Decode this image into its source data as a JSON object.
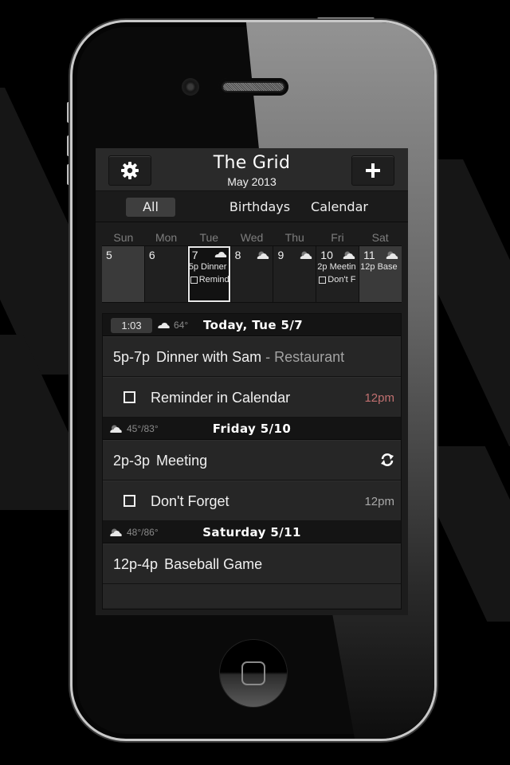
{
  "app": {
    "title": "The Grid",
    "subtitle": "May 2013",
    "settings_icon": "gear-icon",
    "add_icon": "plus-icon"
  },
  "filters": [
    {
      "label": "All",
      "active": true
    },
    {
      "label": "Birthdays",
      "active": false
    },
    {
      "label": "Calendar",
      "active": false
    }
  ],
  "week": {
    "day_names": [
      "Sun",
      "Mon",
      "Tue",
      "Wed",
      "Thu",
      "Fri",
      "Sat"
    ],
    "days": [
      {
        "num": "5",
        "weather": "",
        "event": "",
        "reminder": ""
      },
      {
        "num": "6",
        "weather": "",
        "event": "",
        "reminder": ""
      },
      {
        "num": "7",
        "weather": "cloud-icon",
        "event": "5p Dinner",
        "reminder": "Remind",
        "today": true
      },
      {
        "num": "8",
        "weather": "partly-cloudy-icon",
        "event": "",
        "reminder": ""
      },
      {
        "num": "9",
        "weather": "partly-cloudy-icon",
        "event": "",
        "reminder": ""
      },
      {
        "num": "10",
        "weather": "partly-cloudy-icon",
        "event": "2p Meetin",
        "reminder": "Don't F"
      },
      {
        "num": "11",
        "weather": "partly-cloudy-icon",
        "event": "12p Base",
        "reminder": ""
      }
    ]
  },
  "agenda": {
    "today": {
      "clock": "1:03",
      "temp": "64°",
      "title": "Today, Tue 5/7",
      "event": {
        "time": "5p-7p",
        "title": "Dinner with Sam",
        "location": "- Restaurant"
      },
      "reminder": {
        "title": "Reminder in Calendar",
        "time": "12pm"
      }
    },
    "friday": {
      "temp": "45°/83°",
      "title": "Friday 5/10",
      "event": {
        "time": "2p-3p",
        "title": "Meeting",
        "icon": "repeat-icon"
      },
      "reminder": {
        "title": "Don't Forget",
        "time": "12pm"
      }
    },
    "saturday": {
      "temp": "48°/86°",
      "title": "Saturday 5/11",
      "event": {
        "time": "12p-4p",
        "title": "Baseball Game"
      }
    }
  },
  "colors": {
    "overdue_time": "#c07070",
    "normal_time": "#a8a8a8"
  }
}
